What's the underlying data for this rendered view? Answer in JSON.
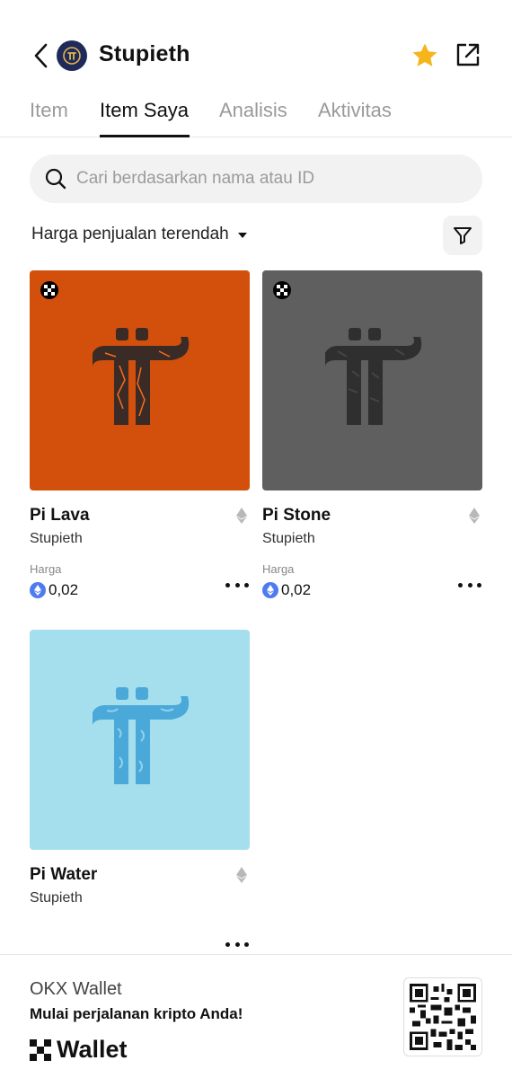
{
  "header": {
    "title": "Stupieth",
    "back_icon": "chevron-left-icon",
    "star_color": "#f5b51b",
    "avatar_bg": "#1f2a5a"
  },
  "tabs": [
    {
      "label": "Item",
      "active": false
    },
    {
      "label": "Item Saya",
      "active": true
    },
    {
      "label": "Analisis",
      "active": false
    },
    {
      "label": "Aktivitas",
      "active": false
    }
  ],
  "search": {
    "placeholder": "Cari berdasarkan nama atau ID",
    "value": ""
  },
  "sort": {
    "label": "Harga penjualan terendah"
  },
  "items": [
    {
      "name": "Pi Lava",
      "collection": "Stupieth",
      "price_label": "Harga",
      "price": "0,02",
      "bg_color": "#d24f0c",
      "logo_color": "#3a2b26"
    },
    {
      "name": "Pi Stone",
      "collection": "Stupieth",
      "price_label": "Harga",
      "price": "0,02",
      "bg_color": "#5f5f5f",
      "logo_color": "#2f2f2f"
    },
    {
      "name": "Pi Water",
      "collection": "Stupieth",
      "price_label": "",
      "price": "",
      "bg_color": "#a5dfee",
      "logo_color": "#4aa9d8"
    }
  ],
  "footer": {
    "title": "OKX Wallet",
    "subtitle": "Mulai perjalanan kripto Anda!",
    "brand": "Wallet"
  }
}
